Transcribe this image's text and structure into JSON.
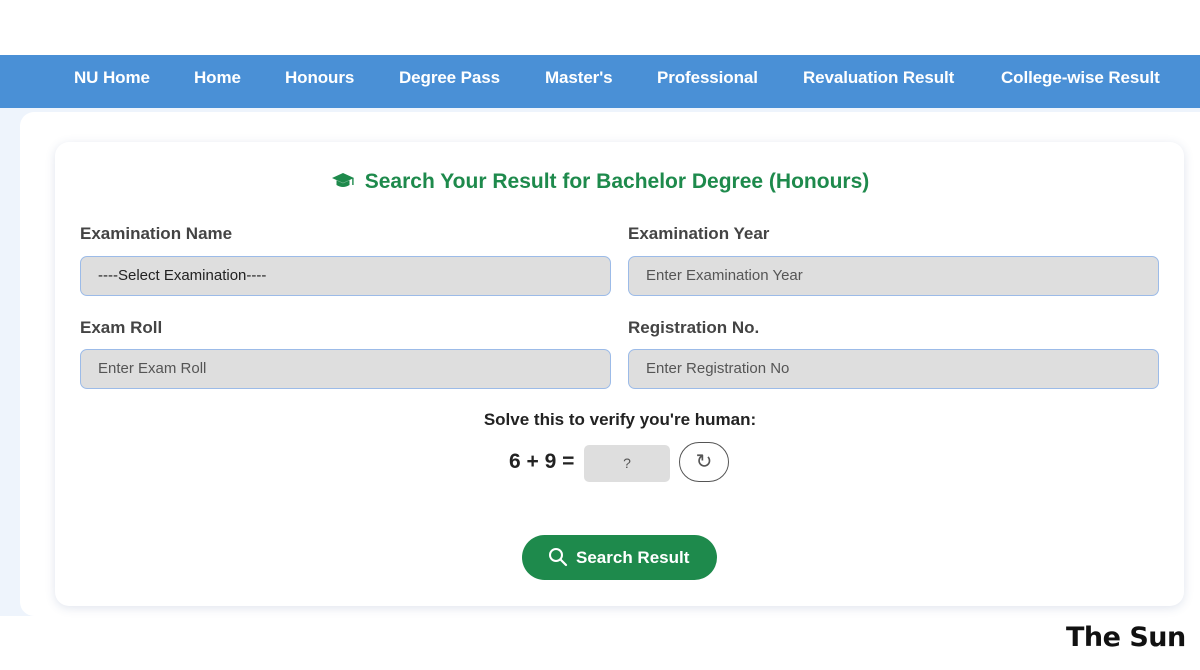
{
  "nav": {
    "items": [
      {
        "label": "NU Home"
      },
      {
        "label": "Home"
      },
      {
        "label": "Honours"
      },
      {
        "label": "Degree Pass"
      },
      {
        "label": "Master's"
      },
      {
        "label": "Professional"
      },
      {
        "label": "Revaluation Result"
      },
      {
        "label": "College-wise Result"
      }
    ]
  },
  "form": {
    "title": "Search Your Result for Bachelor Degree (Honours)",
    "title_icon": "graduation-cap-icon",
    "exam_name": {
      "label": "Examination Name",
      "value": "----Select Examination----"
    },
    "exam_year": {
      "label": "Examination Year",
      "placeholder": "Enter Examination Year"
    },
    "exam_roll": {
      "label": "Exam Roll",
      "placeholder": "Enter Exam Roll"
    },
    "registration": {
      "label": "Registration No.",
      "placeholder": "Enter Registration No"
    },
    "captcha": {
      "prompt": "Solve this to verify you're human:",
      "equation": "6 + 9 =",
      "placeholder": "?",
      "refresh_symbol": "↻"
    },
    "submit_label": "Search Result",
    "submit_icon": "search-icon"
  },
  "watermark": "The Sun",
  "colors": {
    "nav_bg": "#4a90d6",
    "accent_green": "#1e8a4c",
    "input_bg": "#dedede",
    "input_border": "#9cbbe8",
    "page_tint": "#eef4fc"
  }
}
